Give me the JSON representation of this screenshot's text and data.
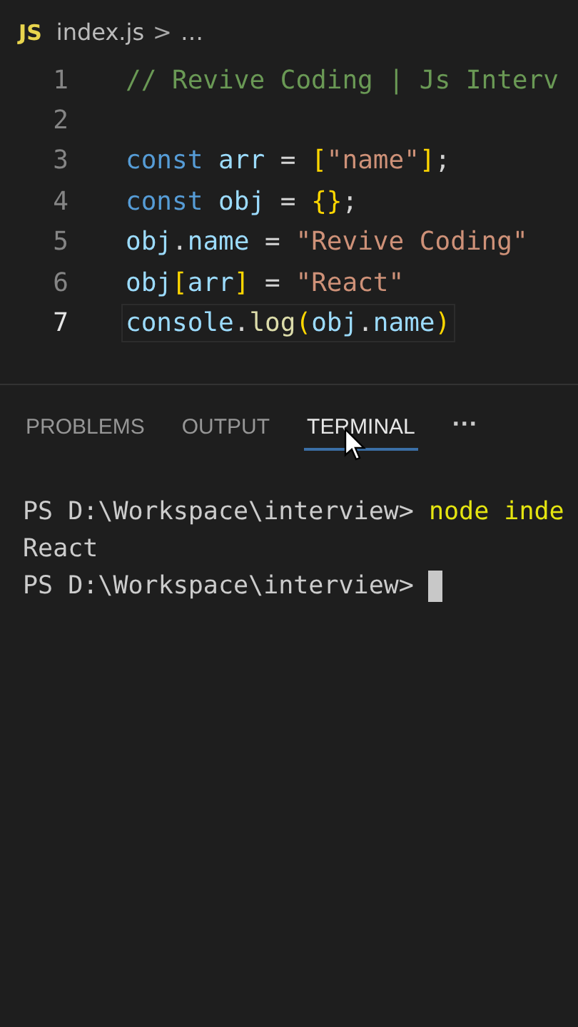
{
  "breadcrumb": {
    "file_badge": "JS",
    "file": "index.js",
    "separator": ">",
    "more": "…"
  },
  "editor": {
    "lines": [
      {
        "number": "1",
        "active": false,
        "tokens": [
          {
            "kind": "comment",
            "text": "// Revive Coding | Js Interv"
          }
        ]
      },
      {
        "number": "2",
        "active": false
      },
      {
        "number": "3",
        "active": false,
        "tokens": [
          {
            "kind": "keyword",
            "text": "const "
          },
          {
            "kind": "variable",
            "text": "arr"
          },
          {
            "kind": "plain",
            "text": " = "
          },
          {
            "kind": "bracket",
            "text": "["
          },
          {
            "kind": "string",
            "text": "\"name\""
          },
          {
            "kind": "bracket",
            "text": "]"
          },
          {
            "kind": "plain",
            "text": ";"
          }
        ]
      },
      {
        "number": "4",
        "active": false,
        "tokens": [
          {
            "kind": "keyword",
            "text": "const "
          },
          {
            "kind": "variable",
            "text": "obj"
          },
          {
            "kind": "plain",
            "text": " = "
          },
          {
            "kind": "bracket",
            "text": "{}"
          },
          {
            "kind": "plain",
            "text": ";"
          }
        ]
      },
      {
        "number": "5",
        "active": false,
        "tokens": [
          {
            "kind": "variable",
            "text": "obj"
          },
          {
            "kind": "plain",
            "text": "."
          },
          {
            "kind": "variable",
            "text": "name"
          },
          {
            "kind": "plain",
            "text": " = "
          },
          {
            "kind": "string",
            "text": "\"Revive Coding\""
          }
        ]
      },
      {
        "number": "6",
        "active": false,
        "tokens": [
          {
            "kind": "variable",
            "text": "obj"
          },
          {
            "kind": "bracket",
            "text": "["
          },
          {
            "kind": "variable",
            "text": "arr"
          },
          {
            "kind": "bracket",
            "text": "]"
          },
          {
            "kind": "plain",
            "text": " = "
          },
          {
            "kind": "string",
            "text": "\"React\""
          }
        ]
      },
      {
        "number": "7",
        "active": true,
        "tokens": [
          {
            "kind": "variable",
            "text": "console"
          },
          {
            "kind": "plain",
            "text": "."
          },
          {
            "kind": "function",
            "text": "log"
          },
          {
            "kind": "bracket",
            "text": "("
          },
          {
            "kind": "variable",
            "text": "obj"
          },
          {
            "kind": "plain",
            "text": "."
          },
          {
            "kind": "variable",
            "text": "name"
          },
          {
            "kind": "bracket",
            "text": ")"
          }
        ]
      }
    ]
  },
  "panel": {
    "tabs": [
      {
        "label": "PROBLEMS",
        "selected": false
      },
      {
        "label": "OUTPUT",
        "selected": false
      },
      {
        "label": "TERMINAL",
        "selected": true
      }
    ],
    "more": "···"
  },
  "terminal": {
    "lines": [
      {
        "prompt": "PS D:\\Workspace\\interview> ",
        "command": "node inde"
      },
      {
        "output": "React"
      },
      {
        "prompt": "PS D:\\Workspace\\interview> ",
        "cursor": true
      }
    ]
  }
}
